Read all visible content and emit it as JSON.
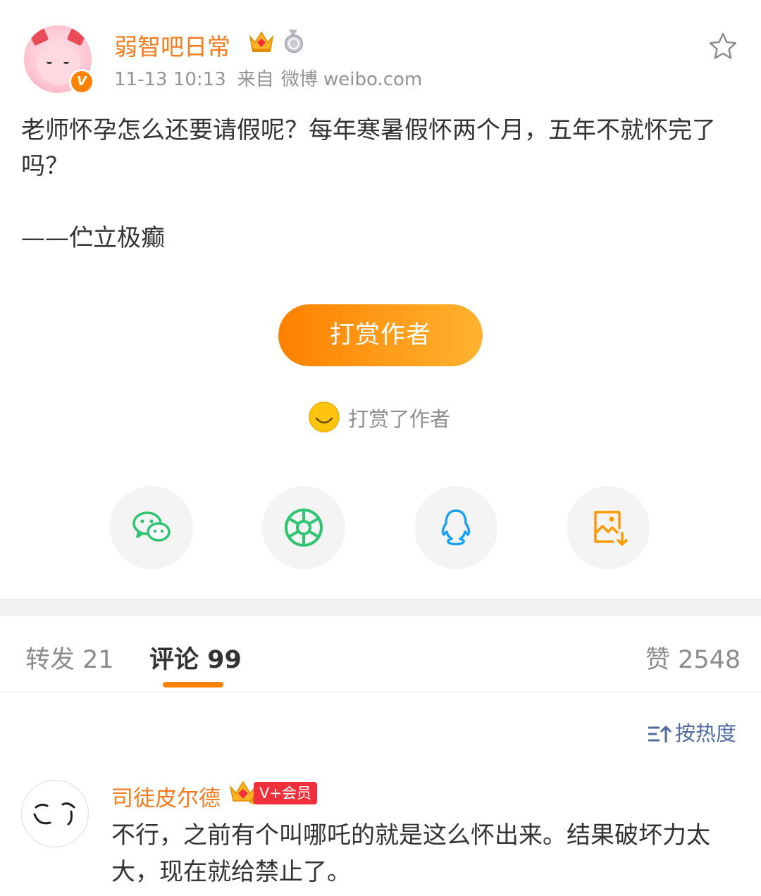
{
  "post": {
    "author": "弱智吧日常",
    "time": "11-13 10:13",
    "source_prefix": "来自",
    "source": "微博 weibo.com",
    "verified_badge": "V",
    "body": "老师怀孕怎么还要请假呢？每年寒暑假怀两个月，五年不就怀完了吗？\n\n——伫立极癫",
    "icons": {
      "favorite": "star-outline-icon",
      "crown": "crown-vip-icon",
      "medal": "medal-icon"
    }
  },
  "reward": {
    "button_label": "打赏作者",
    "rewarded_label": "打赏了作者"
  },
  "share": [
    {
      "name": "wechat",
      "icon": "wechat-icon",
      "color": "#2fc470"
    },
    {
      "name": "moments",
      "icon": "wechat-moments-icon",
      "color": "#2fc470"
    },
    {
      "name": "qq",
      "icon": "qq-icon",
      "color": "#1da1f2"
    },
    {
      "name": "save-image",
      "icon": "save-image-icon",
      "color": "#ff9900"
    }
  ],
  "tabs": {
    "repost": "转发 21",
    "comments": "评论 99",
    "likes": "赞 2548",
    "active": "comments"
  },
  "sort": {
    "label": "按热度"
  },
  "comments": [
    {
      "author": "司徒皮尔德",
      "badge": "V+会员",
      "crown_level": "4",
      "text": "不行，之前有个叫哪吒的就是这么怀出来。结果破坏力太大，现在就给禁止了。"
    }
  ],
  "colors": {
    "accent": "#ff8200",
    "username": "#f77b1b",
    "link": "#4d6aa0",
    "vip": "#f2303b"
  }
}
